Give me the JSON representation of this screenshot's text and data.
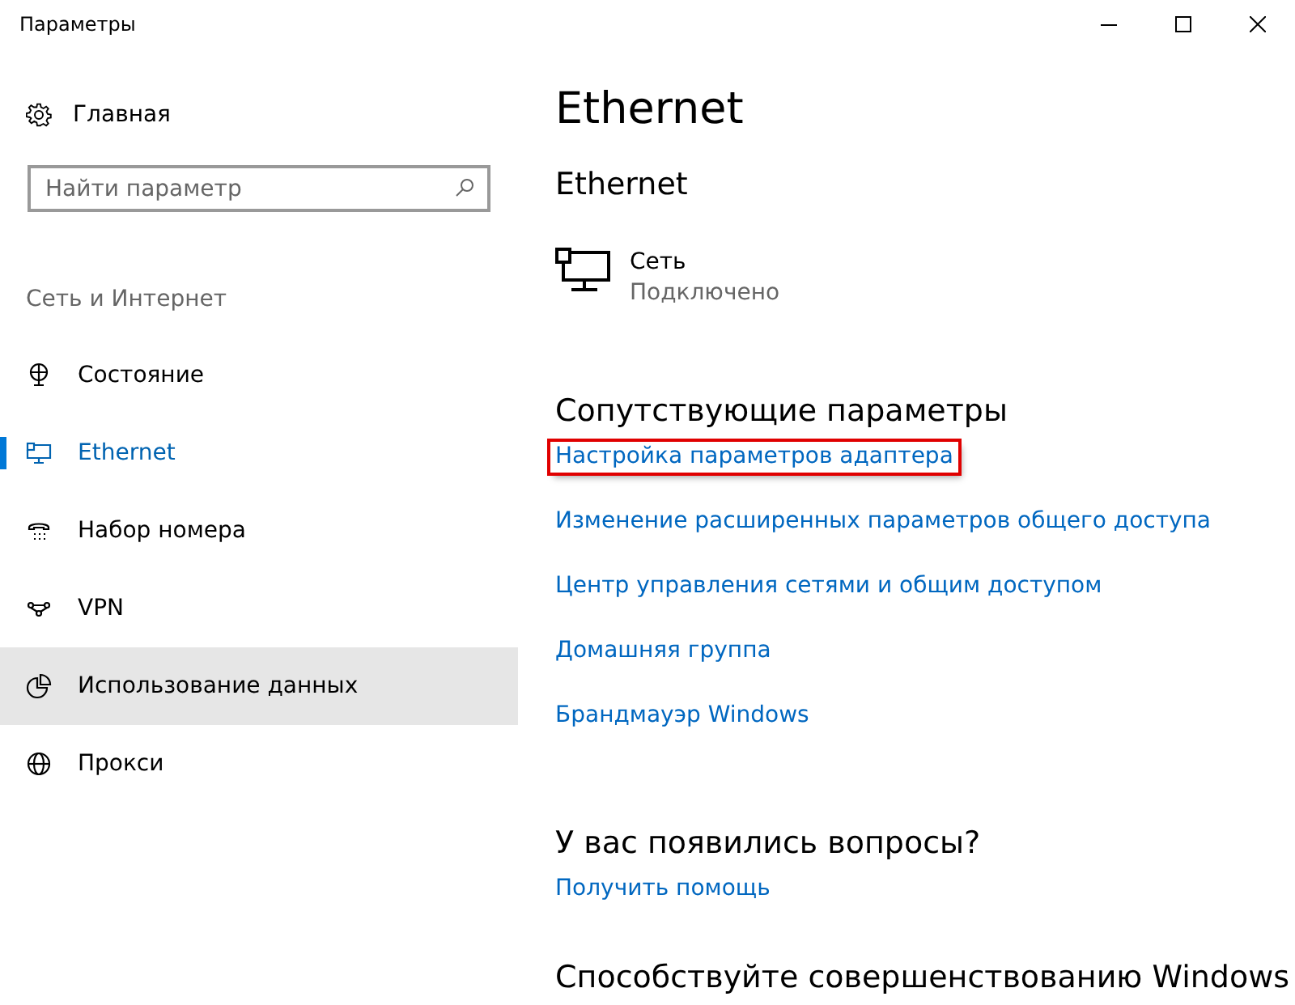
{
  "window": {
    "title": "Параметры",
    "controls": [
      {
        "kind": "minimize"
      },
      {
        "kind": "maximize"
      },
      {
        "kind": "close"
      }
    ]
  },
  "sidebar": {
    "home": "Главная",
    "search": {
      "placeholder": "Найти параметр"
    },
    "section": "Сеть и Интернет",
    "items": [
      {
        "label": "Состояние",
        "kind": "status",
        "selected": false,
        "hovered": false
      },
      {
        "label": "Ethernet",
        "kind": "ethernet",
        "selected": true,
        "hovered": false
      },
      {
        "label": "Набор номера",
        "kind": "dialup",
        "selected": false,
        "hovered": false
      },
      {
        "label": "VPN",
        "kind": "vpn",
        "selected": false,
        "hovered": false
      },
      {
        "label": "Использование данных",
        "kind": "data",
        "selected": false,
        "hovered": true
      },
      {
        "label": "Прокси",
        "kind": "proxy",
        "selected": false,
        "hovered": false
      }
    ]
  },
  "content": {
    "title": "Ethernet",
    "subtitle": "Ethernet",
    "network": {
      "name": "Сеть",
      "status": "Подключено"
    },
    "related": {
      "heading": "Сопутствующие параметры",
      "links": [
        {
          "label": "Настройка параметров адаптера",
          "highlighted": true
        },
        {
          "label": "Изменение расширенных параметров общего доступа",
          "highlighted": false
        },
        {
          "label": "Центр управления сетями и общим доступом",
          "highlighted": false
        },
        {
          "label": "Домашняя группа",
          "highlighted": false
        },
        {
          "label": "Брандмауэр Windows",
          "highlighted": false
        }
      ]
    },
    "questions": {
      "heading": "У вас появились вопросы?",
      "link": "Получить помощь"
    },
    "improve": {
      "heading": "Способствуйте совершенствованию Windows"
    }
  }
}
